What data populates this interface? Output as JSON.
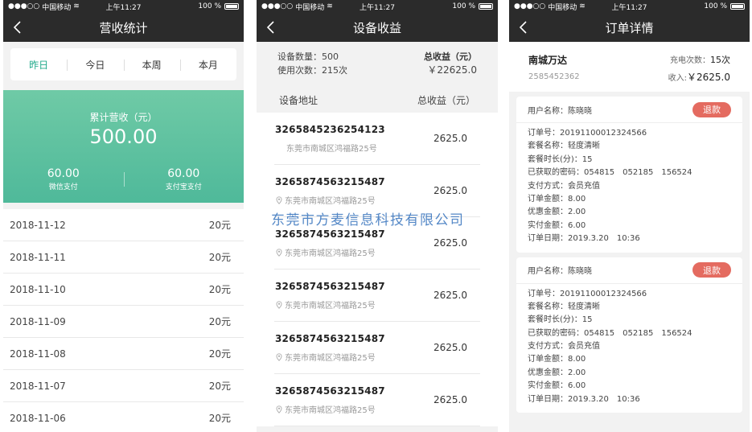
{
  "status": {
    "carrier": "中国移动",
    "time": "上午11:27",
    "battery": "100 %"
  },
  "panel1": {
    "title": "营收统计",
    "tabs": [
      "昨日",
      "今日",
      "本周",
      "本月"
    ],
    "active_tab": 0,
    "total_label": "累计营收（元）",
    "total_value": "500.00",
    "wechat_value": "60.00",
    "wechat_label": "微信支付",
    "alipay_value": "60.00",
    "alipay_label": "支付宝支付",
    "rows": [
      {
        "date": "2018-11-12",
        "amount": "20元"
      },
      {
        "date": "2018-11-11",
        "amount": "20元"
      },
      {
        "date": "2018-11-10",
        "amount": "20元"
      },
      {
        "date": "2018-11-09",
        "amount": "20元"
      },
      {
        "date": "2018-11-08",
        "amount": "20元"
      },
      {
        "date": "2018-11-07",
        "amount": "20元"
      },
      {
        "date": "2018-11-06",
        "amount": "20元"
      }
    ]
  },
  "panel2": {
    "title": "设备收益",
    "device_count": "设备数量：500",
    "use_count": "使用次数：215次",
    "total_label": "总收益（元）",
    "total_value": "￥22625.0",
    "col_address": "设备地址",
    "col_total": "总收益（元）",
    "rows": [
      {
        "id": "3265845236254123",
        "addr": "东莞市南城区鸿福路25号",
        "amount": "2625.0",
        "pin": false
      },
      {
        "id": "3265874563215487",
        "addr": "东莞市南城区鸿福路25号",
        "amount": "2625.0",
        "pin": true
      },
      {
        "id": "3265874563215487",
        "addr": "东莞市南城区鸿福路25号",
        "amount": "2625.0",
        "pin": true
      },
      {
        "id": "3265874563215487",
        "addr": "东莞市南城区鸿福路25号",
        "amount": "2625.0",
        "pin": true
      },
      {
        "id": "3265874563215487",
        "addr": "东莞市南城区鸿福路25号",
        "amount": "2625.0",
        "pin": true
      },
      {
        "id": "3265874563215487",
        "addr": "东莞市南城区鸿福路25号",
        "amount": "2625.0",
        "pin": true
      }
    ]
  },
  "panel3": {
    "title": "订单详情",
    "store_name": "南城万达",
    "store_id": "2585452362",
    "charge_label": "充电次数：",
    "charge_value": "15次",
    "income_label": "收入:",
    "income_value": "￥2625.0",
    "refund_label": "退款",
    "cards": [
      {
        "user": "用户名称：陈晓晓",
        "lines": [
          "订单号：20191100012324566",
          "套餐名称：轻度清晰",
          "套餐时长(分)：15",
          "已获取的密码：054815　052185　156524",
          "支付方式：会员充值",
          "订单金额：8.00",
          "优惠金额：2.00",
          "实付金额：6.00",
          "订单日期：2019.3.20　10:36"
        ]
      },
      {
        "user": "用户名称：陈晓晓",
        "lines": [
          "订单号：20191100012324566",
          "套餐名称：轻度清晰",
          "套餐时长(分)：15",
          "已获取的密码：054815　052185　156524",
          "支付方式：会员充值",
          "订单金额：8.00",
          "优惠金额：2.00",
          "实付金额：6.00",
          "订单日期：2019.3.20　10:36"
        ]
      }
    ]
  },
  "watermark": "东莞市方麦信息科技有限公司"
}
